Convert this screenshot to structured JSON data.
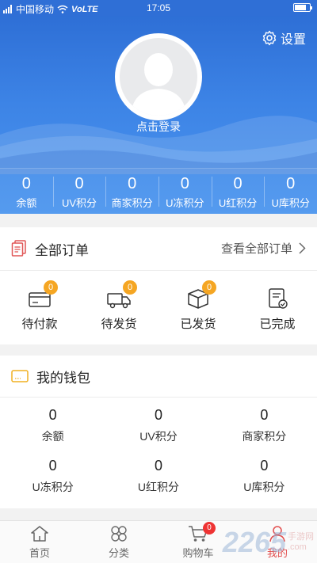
{
  "status_bar": {
    "carrier": "中国移动",
    "network": "VoLTE",
    "time": "17:05"
  },
  "header": {
    "settings_label": "设置",
    "login_text": "点击登录",
    "stats": [
      {
        "value": "0",
        "label": "余额"
      },
      {
        "value": "0",
        "label": "UV积分"
      },
      {
        "value": "0",
        "label": "商家积分"
      },
      {
        "value": "0",
        "label": "U冻积分"
      },
      {
        "value": "0",
        "label": "U红积分"
      },
      {
        "value": "0",
        "label": "U库积分"
      }
    ]
  },
  "orders": {
    "title": "全部订单",
    "view_all": "查看全部订单",
    "items": [
      {
        "label": "待付款",
        "badge": "0",
        "icon": "wallet-card-icon"
      },
      {
        "label": "待发货",
        "badge": "0",
        "icon": "truck-icon"
      },
      {
        "label": "已发货",
        "badge": "0",
        "icon": "package-icon"
      },
      {
        "label": "已完成",
        "icon": "completed-doc-icon"
      }
    ]
  },
  "wallet": {
    "title": "我的钱包",
    "items": [
      {
        "value": "0",
        "label": "余额"
      },
      {
        "value": "0",
        "label": "UV积分"
      },
      {
        "value": "0",
        "label": "商家积分"
      },
      {
        "value": "0",
        "label": "U冻积分"
      },
      {
        "value": "0",
        "label": "U红积分"
      },
      {
        "value": "0",
        "label": "U库积分"
      }
    ]
  },
  "tabbar": {
    "items": [
      {
        "label": "首页",
        "icon": "home-icon"
      },
      {
        "label": "分类",
        "icon": "category-icon"
      },
      {
        "label": "购物车",
        "icon": "cart-icon",
        "badge": "0"
      },
      {
        "label": "我的",
        "icon": "profile-icon"
      }
    ]
  },
  "watermark": {
    "brand": "2265",
    "text": "手游网",
    "domain": ".com"
  },
  "colors": {
    "primary_blue": "#2f6fd6",
    "badge_orange": "#f5a623",
    "active_red": "#e24c4c"
  }
}
